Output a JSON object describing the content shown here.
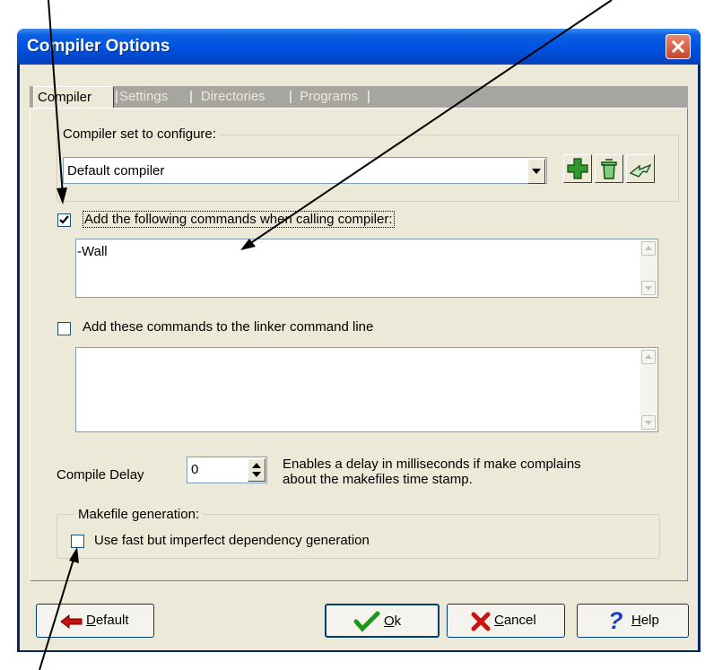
{
  "window": {
    "title": "Compiler Options",
    "close_label": "×"
  },
  "tabs": [
    {
      "label": "Compiler",
      "active": true
    },
    {
      "label": "Settings"
    },
    {
      "label": "Directories"
    },
    {
      "label": "Programs"
    }
  ],
  "compiler_set": {
    "group_label": "Compiler set to configure:",
    "selected": "Default compiler"
  },
  "compiler_commands": {
    "label": "Add the following commands when calling compiler:",
    "checked": true,
    "value": "-Wall"
  },
  "linker_commands": {
    "label": "Add these commands to the linker command line",
    "checked": false,
    "value": ""
  },
  "compile_delay": {
    "label": "Compile Delay",
    "value": "0",
    "description_line1": "Enables a delay in milliseconds if make complains",
    "description_line2": "about the makefiles time stamp."
  },
  "makefile": {
    "group_label": "Makefile generation:",
    "option_label": "Use fast but imperfect dependency generation",
    "checked": false
  },
  "buttons": {
    "default": {
      "mnemonic": "D",
      "rest": "efault"
    },
    "ok": {
      "mnemonic": "O",
      "rest": "k"
    },
    "cancel": {
      "mnemonic": "C",
      "rest": "ancel"
    },
    "help": {
      "mnemonic": "H",
      "rest": "elp"
    }
  },
  "colors": {
    "titlebar": "#0054e3",
    "face": "#ece9d8",
    "close_button": "#c8442a",
    "add_icon": "#2e9a2e",
    "ok_check": "#1a9a1a",
    "cancel_x": "#cc1111",
    "help_q": "#1a3fc0"
  }
}
